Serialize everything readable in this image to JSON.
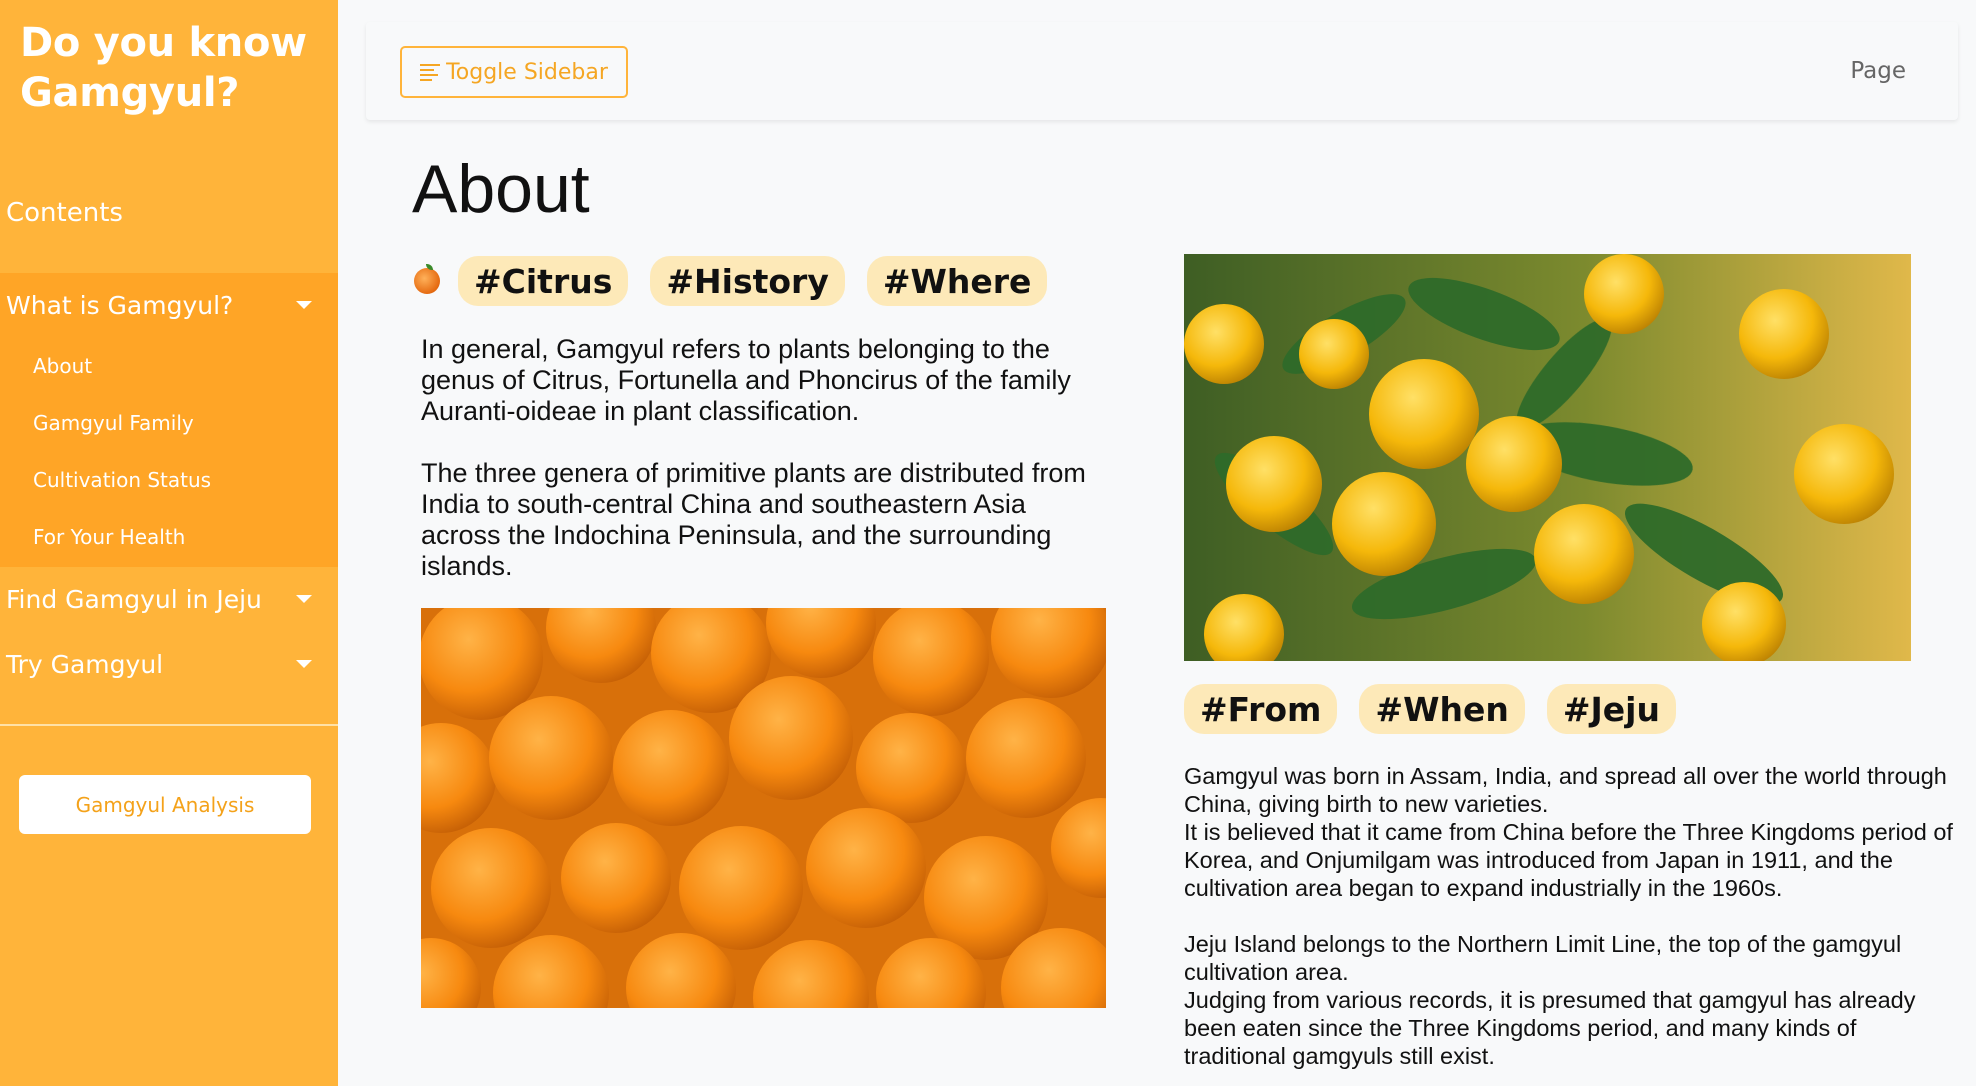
{
  "sidebar": {
    "brand": "Do you know Gamgyul?",
    "contents_heading": "Contents",
    "groups": [
      {
        "label": "What is Gamgyul?",
        "items": [
          "About",
          "Gamgyul Family",
          "Cultivation Status",
          "For Your Health"
        ]
      },
      {
        "label": "Find Gamgyul in Jeju"
      },
      {
        "label": "Try Gamgyul"
      }
    ],
    "analysis_button": "Gamgyul Analysis"
  },
  "topbar": {
    "toggle_label": "Toggle Sidebar",
    "page_link": "Page"
  },
  "main": {
    "title": "About",
    "tags_left": [
      "#Citrus",
      "#History",
      "#Where"
    ],
    "para_left_1": "In general, Gamgyul refers to plants belonging to the genus of Citrus, Fortunella and Phoncirus of the family Auranti-oideae in plant classification.",
    "para_left_2": "The three genera of primitive plants are distributed from India to south-central China and southeastern Asia across the Indochina Peninsula, and the surrounding islands.",
    "tags_right": [
      "#From",
      "#When",
      "#Jeju"
    ],
    "para_right_1": "Gamgyul was born in Assam, India, and spread all over the world through China, giving birth to new varieties.",
    "para_right_2": "It is believed that it came from China before the Three Kingdoms period of Korea, and Onjumilgam was introduced from Japan in 1911, and the cultivation area began to expand industrially in the 1960s.",
    "para_right_3": "Jeju Island belongs to the Northern Limit Line, the top of the gamgyul cultivation area.",
    "para_right_4": "Judging from various records, it is presumed that gamgyul has already been eaten since the Three Kingdoms period, and many kinds of traditional gamgyuls still exist."
  },
  "colors": {
    "sidebar": "#ffb43a",
    "sidebar_active": "#ffa526",
    "tag_bg": "#fde9b8",
    "accent": "#f5a623"
  }
}
